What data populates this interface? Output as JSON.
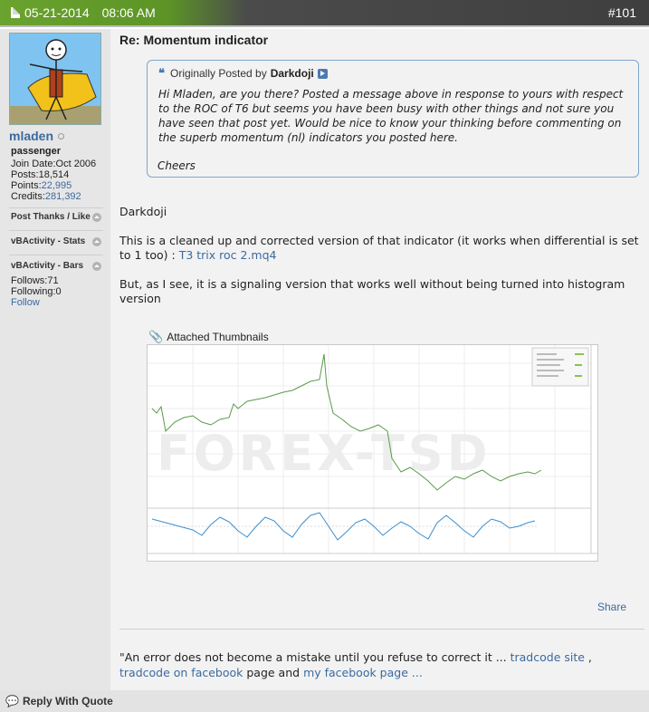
{
  "post": {
    "date": "05-21-2014",
    "time": "08:06 AM",
    "number": "#101",
    "title": "Re: Momentum indicator"
  },
  "user": {
    "name": "mladen",
    "rank": "passenger",
    "join_label": "Join Date:",
    "join_date": "Oct 2006",
    "posts_label": "Posts:",
    "posts": "18,514",
    "points_label": "Points:",
    "points": "22,995",
    "credits_label": "Credits:",
    "credits": "281,392"
  },
  "sidebar": {
    "thanks": "Post Thanks / Like",
    "stats": "vBActivity - Stats",
    "bars": "vBActivity - Bars",
    "follows": "Follows:71",
    "following": "Following:0",
    "follow": "Follow"
  },
  "quote": {
    "prefix": "Originally Posted by",
    "author": "Darkdoji",
    "text": "Hi Mladen, are you there? Posted a message above in response to yours with respect to the ROC of T6 but seems you have been busy with other things and not sure you have seen that post yet. Would be nice to know your thinking before commenting on the superb momentum (nl) indicators you posted here.",
    "sign": "Cheers"
  },
  "body": {
    "greeting": "Darkdoji",
    "p1": "This is a cleaned up and corrected version of that indicator (it works when differential is set to 1 too) : ",
    "p1_link": "T3 trix roc 2.mq4",
    "p2": "But, as I see, it is a signaling version that works well without being turned into histogram version"
  },
  "attachments": {
    "label": "Attached Thumbnails"
  },
  "share": "Share",
  "signature": {
    "text1": "\"An error does not become a mistake until you refuse to correct it ... ",
    "link1": "tradcode site",
    "text2": " , ",
    "link2": "tradcode on facebook",
    "text3": " page and ",
    "link3": "my facebook page ..."
  },
  "footer": {
    "reply": "Reply With Quote"
  },
  "colors": {
    "header_green": "#6ba32f",
    "header_dark": "#3f3f3f",
    "link": "#3b6aa0",
    "price_line": "#5a9a4a",
    "indicator_line": "#3a8fd0"
  }
}
